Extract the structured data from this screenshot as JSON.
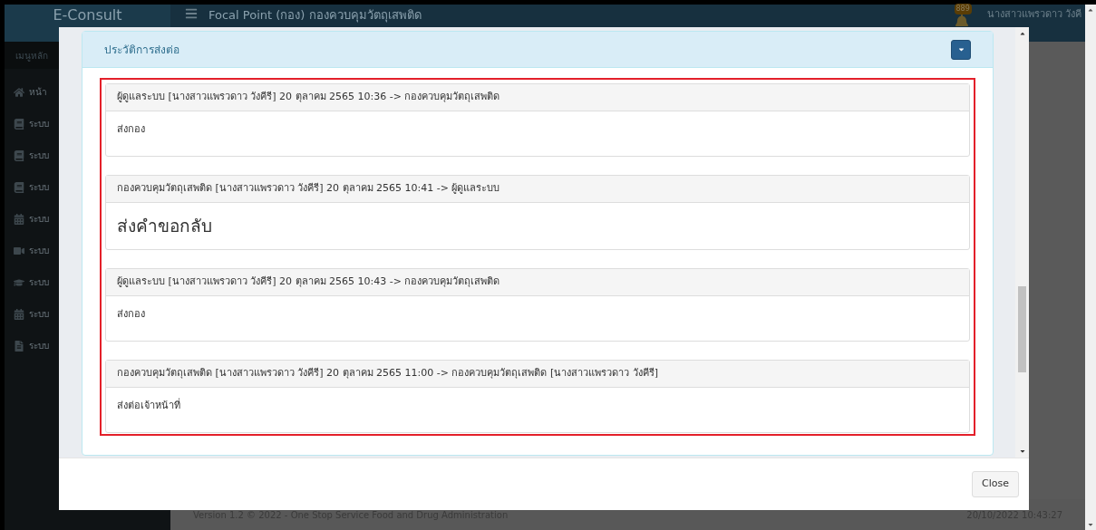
{
  "app": {
    "brand": "E-Consult",
    "page_title": "Focal Point (กอง) กองควบคุมวัตถุเสพติด",
    "notification_count": "889",
    "user_name": "นางสาวแพรวดาว วังคี"
  },
  "sidebar": {
    "heading": "เมนูหลัก",
    "items": [
      {
        "label": "หน้า",
        "kind": "home"
      },
      {
        "label": "ระบบ",
        "kind": "book"
      },
      {
        "label": "ระบบ",
        "kind": "book"
      },
      {
        "label": "ระบบ",
        "kind": "book"
      },
      {
        "label": "ระบบ",
        "kind": "calendar"
      },
      {
        "label": "ระบบ",
        "kind": "video"
      },
      {
        "label": "ระบบ",
        "kind": "graduation"
      },
      {
        "label": "ระบบ",
        "kind": "calendar"
      },
      {
        "label": "ระบบ",
        "kind": "file"
      }
    ]
  },
  "footer": {
    "version": "Version 1.2 © 2022 - One Stop Service Food and Drug Administration",
    "datetime": "20/10/2022 10:43:27"
  },
  "modal": {
    "panel_title": "ประวัติการส่งต่อ",
    "entries": [
      {
        "header": "ผู้ดูแลระบบ [นางสาวแพรวดาว วังคีรี] 20 ตุลาคม 2565 10:36 -> กองควบคุมวัตถุเสพติด",
        "message": "ส่งกอง",
        "kind": "normal"
      },
      {
        "header": "กองควบคุมวัตถุเสพติด [นางสาวแพรวดาว วังคีรี] 20 ตุลาคม 2565 10:41 -> ผู้ดูแลระบบ",
        "message": "ส่งคำขอกลับ",
        "kind": "large"
      },
      {
        "header": "ผู้ดูแลระบบ [นางสาวแพรวดาว วังคีรี] 20 ตุลาคม 2565 10:43 -> กองควบคุมวัตถุเสพติด",
        "message": "ส่งกอง",
        "kind": "normal"
      },
      {
        "header": "กองควบคุมวัตถุเสพติด [นางสาวแพรวดาว วังคีรี] 20 ตุลาคม 2565 11:00 -> กองควบคุมวัตถุเสพติด [นางสาวแพรวดาว วังคีรี]",
        "message": "ส่งต่อเจ้าหน้าที่",
        "kind": "normal"
      }
    ],
    "close_button": "Close"
  }
}
